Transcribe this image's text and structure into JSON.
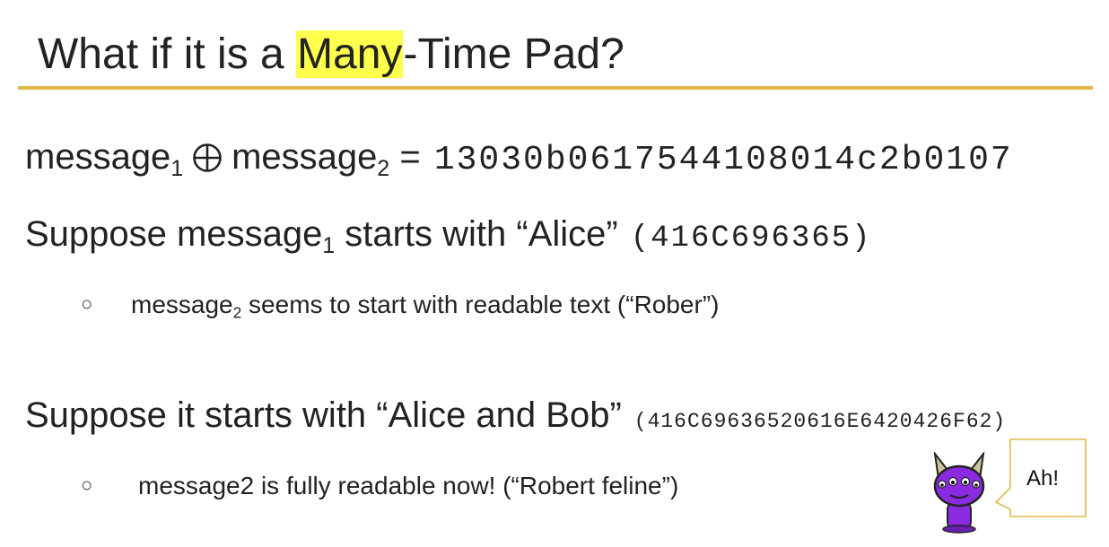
{
  "slide": {
    "title": {
      "pre": "What if it is a ",
      "highlight": "Many",
      "post": "-Time Pad?"
    },
    "line1": {
      "word_a": "message",
      "sub_a": "1",
      "word_b": "message",
      "sub_b": "2",
      "equals": " = ",
      "hex": "13030b0617544108014c2b0107"
    },
    "line2": {
      "text_a": "Suppose message",
      "sub": "1",
      "text_b": " starts with “Alice”",
      "hex": "(416C696365)"
    },
    "bullet1": {
      "marker": "○",
      "text_a": "message",
      "sub": "2",
      "text_b": " seems to start with readable text (“Rober”)"
    },
    "line3": {
      "text": "Suppose it starts with “Alice and Bob”",
      "hex": "(416C69636520616E6420426F62)"
    },
    "bullet2": {
      "marker": "○",
      "text": "message2 is fully readable now! (“Robert feline”)"
    },
    "speech_bubble": "Ah!"
  },
  "colors": {
    "highlight": "#ffff4d",
    "rule": "#e0b84a",
    "mascot_body": "#8a2be2",
    "mascot_horns": "#c8c89a"
  }
}
